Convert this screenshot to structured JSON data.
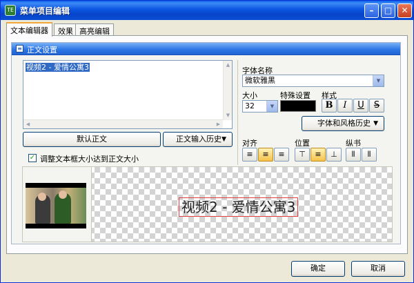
{
  "window": {
    "title": "菜单项目编辑",
    "app_icon_text": "TE"
  },
  "titlebar_buttons": {
    "minimize": "–",
    "maximize": "□",
    "close": "✕"
  },
  "tabs": [
    {
      "label": "文本编辑器",
      "active": true
    },
    {
      "label": "效果",
      "active": false
    },
    {
      "label": "高亮编辑",
      "active": false
    }
  ],
  "group": {
    "title": "正文设置",
    "icon": "icon-doc"
  },
  "editor": {
    "text": "视频2 - 爱情公寓3"
  },
  "buttons": {
    "default_text": "默认正文",
    "text_input_history": "正文输入历史",
    "font_style_history": "字体和风格历史",
    "ok": "确定",
    "cancel": "取消"
  },
  "checkbox": {
    "label": "调整文本框大小达到正文大小",
    "checked": true
  },
  "font": {
    "name_label": "字体名称",
    "name_value": "微软雅黑",
    "size_label": "大小",
    "size_value": "32",
    "special_label": "特殊设置",
    "style_label": "样式",
    "color": "#000000",
    "style_buttons": [
      "B",
      "I",
      "U",
      "S"
    ]
  },
  "align": {
    "align_label": "对齐",
    "position_label": "位置",
    "vertical_label": "纵书",
    "align_selected": "center",
    "position_selected": "middle"
  },
  "preview": {
    "text": "视频2 - 爱情公寓3"
  },
  "colors": {
    "accent_title": "#0a5ee6",
    "selection": "#316ac5",
    "outline_red": "#e04040"
  }
}
